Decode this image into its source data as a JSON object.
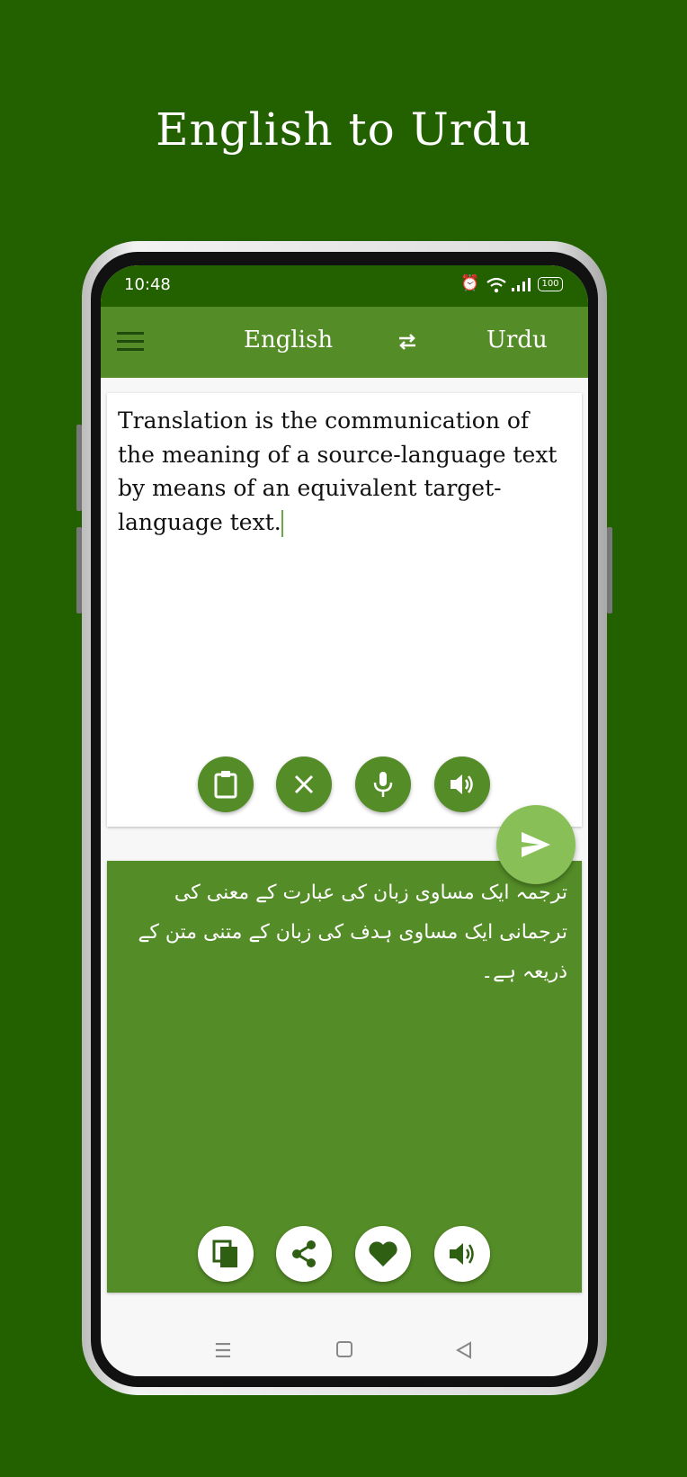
{
  "promo_title": "English to Urdu",
  "status_bar": {
    "time": "10:48",
    "battery": "100",
    "icons": [
      "alarm-icon",
      "wifi-icon",
      "signal-icon",
      "battery-icon"
    ]
  },
  "app_bar": {
    "source_language": "English",
    "target_language": "Urdu",
    "icons": [
      "menu-icon",
      "swap-icon"
    ]
  },
  "input": {
    "text": "Translation is the communication of the meaning of a source-language text by means of an equivalent target-language text.",
    "actions": [
      "clipboard-icon",
      "clear-icon",
      "mic-icon",
      "speaker-icon"
    ]
  },
  "output": {
    "text": "ترجمہ ایک مساوی زبان کی عبارت کے معنی کی ترجمانی ایک مساوی ہدف کی زبان کے متنی متن کے ذریعہ ہے۔",
    "actions": [
      "copy-icon",
      "share-icon",
      "favorite-icon",
      "speaker-icon"
    ]
  },
  "colors": {
    "background": "#236000",
    "app_bar": "#548c27",
    "output_card": "#548c27",
    "fab": "#88c057"
  }
}
